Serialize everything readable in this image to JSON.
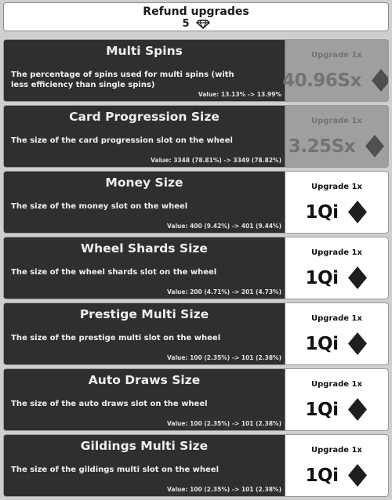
{
  "header": {
    "title": "Refund upgrades",
    "gems": "5"
  },
  "upgrades": [
    {
      "name": "Multi Spins",
      "description": "The percentage of spins used for multi spins (with less efficiency than single spins)",
      "value": "Value: 13.13% -> 13.99%",
      "button_label": "Upgrade 1x",
      "cost": "40.96Sx",
      "affordable": false
    },
    {
      "name": "Card Progression Size",
      "description": "The size of the card progression slot on the wheel",
      "value": "Value: 3348 (78.81%) -> 3349 (78.82%)",
      "button_label": "Upgrade 1x",
      "cost": "3.25Sx",
      "affordable": false
    },
    {
      "name": "Money Size",
      "description": "The size of the money slot on the wheel",
      "value": "Value: 400 (9.42%) -> 401 (9.44%)",
      "button_label": "Upgrade 1x",
      "cost": "1Qi",
      "affordable": true
    },
    {
      "name": "Wheel Shards Size",
      "description": "The size of the wheel shards slot on the wheel",
      "value": "Value: 200 (4.71%) -> 201 (4.73%)",
      "button_label": "Upgrade 1x",
      "cost": "1Qi",
      "affordable": true
    },
    {
      "name": "Prestige Multi Size",
      "description": "The size of the prestige multi slot on the wheel",
      "value": "Value: 100 (2.35%) -> 101 (2.38%)",
      "button_label": "Upgrade 1x",
      "cost": "1Qi",
      "affordable": true
    },
    {
      "name": "Auto Draws Size",
      "description": "The size of the auto draws slot on the wheel",
      "value": "Value: 100 (2.35%) -> 101 (2.38%)",
      "button_label": "Upgrade 1x",
      "cost": "1Qi",
      "affordable": true
    },
    {
      "name": "Gildings Multi Size",
      "description": "The size of the gildings multi slot on the wheel",
      "value": "Value: 100 (2.35%) -> 101 (2.38%)",
      "button_label": "Upgrade 1x",
      "cost": "1Qi",
      "affordable": true
    }
  ],
  "icons": {
    "currency": "diamond-gem-icon"
  },
  "colors": {
    "panel": "#2f2f2f",
    "button": "#ffffff",
    "locked_button": "#cfcfcf"
  }
}
